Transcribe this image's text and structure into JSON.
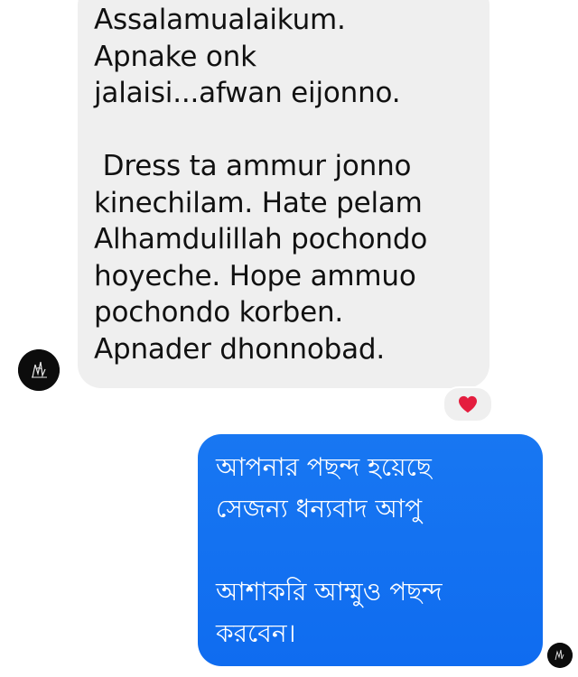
{
  "conversation": {
    "incoming_message": {
      "text": "Assalamualaikum.\nApnake onk\njalaisi...afwan eijonno.\n\n Dress ta ammur jonno\nkinechilam. Hate pelam\nAlhamdulillah pochondo\nhoyeche. Hope ammuo\npochondo korben.\nApnader dhonnobad.",
      "bubble_color": "#efefef",
      "reaction": "heart-icon"
    },
    "outgoing_message": {
      "text": "আপনার পছন্দ হয়েছে\nসেজন্য ধন্যবাদ আপু\n\nআশাকরি আম্মুও পছন্দ\nকরবেন।",
      "bubble_color": "#1877f2"
    },
    "accent_heart_color": "#e41e3f"
  }
}
